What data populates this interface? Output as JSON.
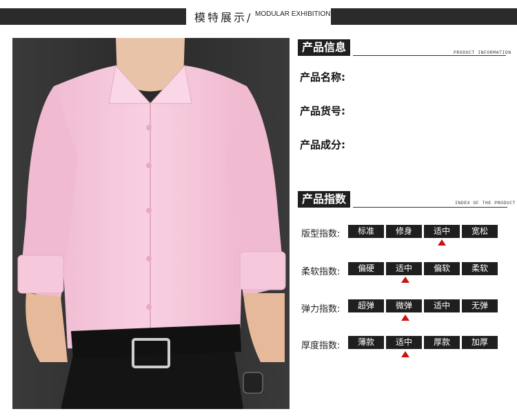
{
  "banner": {
    "title": "模特展示/",
    "subtitle": "MODULAR EXHIBITION"
  },
  "product_info": {
    "heading": "产品信息",
    "heading_en": "PRODUCT INFORMATION",
    "rows": [
      "产品名称:",
      "产品货号:",
      "产品成分:"
    ]
  },
  "product_index": {
    "heading": "产品指数",
    "heading_en": "INDEX OF THE PRODUCT",
    "rows": [
      {
        "label": "版型指数:",
        "options": [
          "标准",
          "修身",
          "适中",
          "宽松"
        ],
        "selected_index": 2
      },
      {
        "label": "柔软指数:",
        "options": [
          "偏硬",
          "适中",
          "偏软",
          "柔软"
        ],
        "selected_index": 1
      },
      {
        "label": "弹力指数:",
        "options": [
          "超弹",
          "微弹",
          "适中",
          "无弹"
        ],
        "selected_index": 1
      },
      {
        "label": "厚度指数:",
        "options": [
          "薄款",
          "适中",
          "厚款",
          "加厚"
        ],
        "selected_index": 1
      }
    ]
  },
  "colors": {
    "dark": "#1f1f1f",
    "marker": "#cc1111",
    "shirt": "#f6c8dc"
  }
}
